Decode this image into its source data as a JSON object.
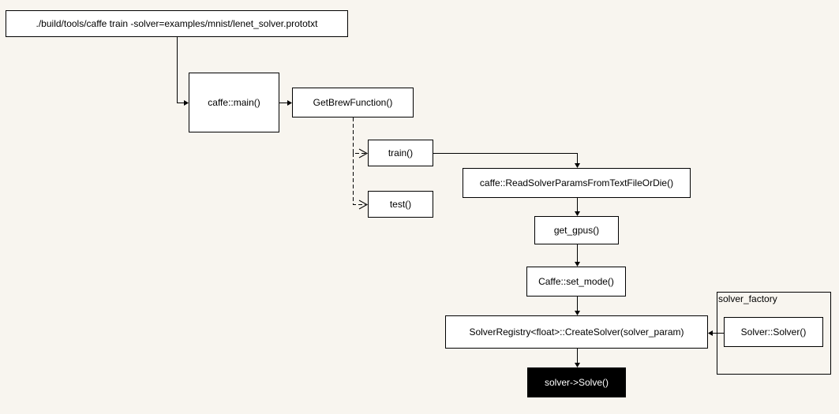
{
  "nodes": {
    "command": "./build/tools/caffe train -solver=examples/mnist/lenet_solver.prototxt",
    "main": "caffe::main()",
    "get_brew": "GetBrewFunction()",
    "train": "train()",
    "test": "test()",
    "read_params": "caffe::ReadSolverParamsFromTextFileOrDie()",
    "get_gpus": "get_gpus()",
    "set_mode": "Caffe::set_mode()",
    "create_solver": "SolverRegistry<float>::CreateSolver(solver_param)",
    "solve": "solver->Solve()",
    "solver_ctor": "Solver::Solver()"
  },
  "groups": {
    "solver_factory": "solver_factory"
  }
}
